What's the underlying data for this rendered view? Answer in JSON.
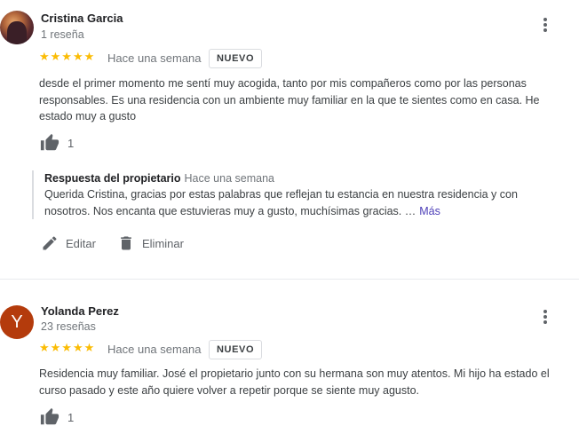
{
  "reviews": [
    {
      "author": "Cristina Garcia",
      "review_count": "1 reseña",
      "stars": "★★★★★",
      "rating": 5,
      "date": "Hace una semana",
      "badge": "NUEVO",
      "text": "desde el primer momento me sentí muy acogida, tanto por mis compañeros como por las personas responsables. Es una residencia con un ambiente muy familiar en la que te sientes como en casa. He estado muy a gusto",
      "likes": "1",
      "owner_response": {
        "title": "Respuesta del propietario",
        "date": "Hace una semana",
        "text": "Querida Cristina, gracias por estas palabras que reflejan tu estancia en nuestra residencia y con nosotros. Nos encanta que estuvieras muy a gusto, muchísimas gracias. …",
        "more_label": "Más"
      },
      "actions": {
        "edit_label": "Editar",
        "delete_label": "Eliminar"
      }
    },
    {
      "author": "Yolanda Perez",
      "avatar_letter": "Y",
      "review_count": "23 reseñas",
      "stars": "★★★★★",
      "rating": 5,
      "date": "Hace una semana",
      "badge": "NUEVO",
      "text": "Residencia muy familiar. José el propietario junto con su hermana son muy atentos.  Mi hijo ha estado el curso pasado y este año quiere volver a repetir porque se siente muy agusto.",
      "likes": "1"
    }
  ],
  "colors": {
    "star": "#fbbc04",
    "avatar_y": "#b43b0c",
    "more_link": "#4d3fb8",
    "muted_text": "#70757a"
  },
  "icons": [
    "more-vert-icon",
    "thumb-up-icon",
    "edit-icon",
    "delete-icon"
  ]
}
